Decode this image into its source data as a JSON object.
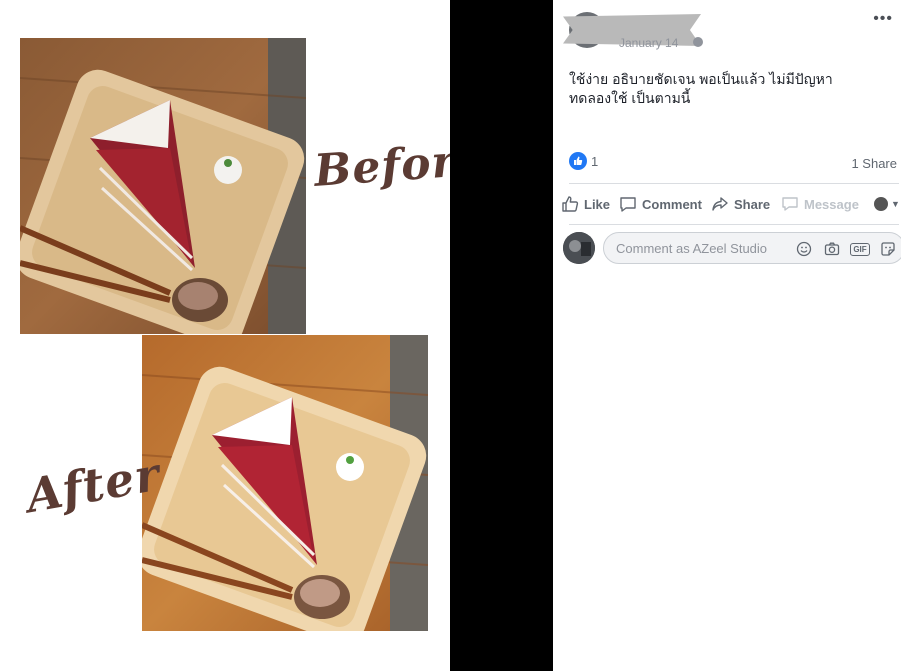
{
  "collage": {
    "before_label": "Before",
    "after_label": "After"
  },
  "post": {
    "date": "January 14",
    "more_label": "•••",
    "text": "ใช้ง่าย อธิบายชัดเจน พอเป็นแล้ว ไม่มีปัญหา\nทดลองใช้ เป็นตามนี้",
    "like_count": "1",
    "share_count": "1 Share",
    "actions": {
      "like": "Like",
      "comment": "Comment",
      "share": "Share",
      "message": "Message"
    },
    "comment_placeholder": "Comment as AZeel Studio",
    "comment_icons": [
      "emoji-icon",
      "camera-icon",
      "gif-icon",
      "sticker-icon"
    ],
    "gif_label": "GIF",
    "colors": {
      "like_blue": "#2078f4",
      "text": "#1d2129",
      "muted": "#606770",
      "script_brown": "#5b3b33"
    }
  }
}
